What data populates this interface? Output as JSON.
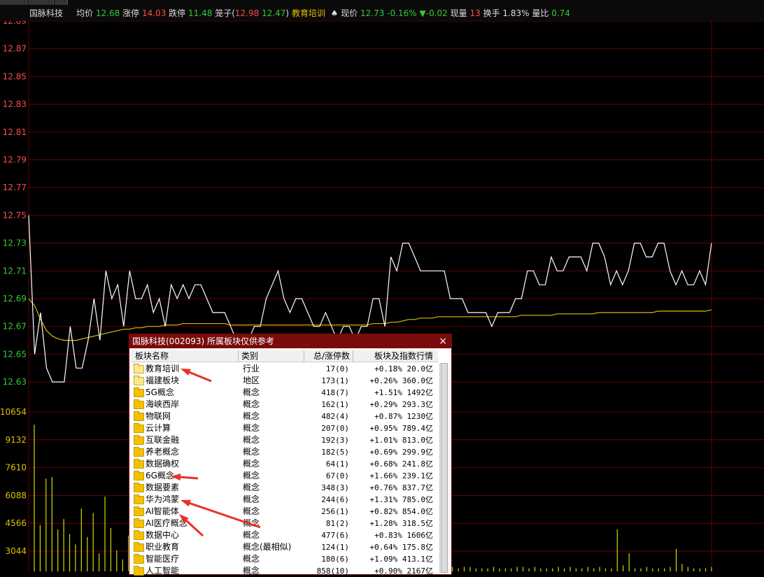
{
  "header": {
    "stock_name": "国脉科技",
    "avg_label": "均价",
    "avg_value": "12.68",
    "limit_up_label": "涨停",
    "limit_up_value": "14.03",
    "limit_down_label": "跌停",
    "limit_down_value": "11.48",
    "bidask_label": "笼子(",
    "bidask_high": "12.98",
    "bidask_low": "12.47",
    "bidask_close": ")",
    "sector": "教育培训",
    "price_label": "现价",
    "price_value": "12.73",
    "change_pct": "-0.16%",
    "change_arrow": "▼",
    "change_value": "-0.02",
    "volume_label": "现量",
    "volume_value": "13",
    "turnover_label": "换手",
    "turnover_value": "1.83%",
    "vol_ratio_label": "量比",
    "vol_ratio_value": "0.74"
  },
  "colors": {
    "up": "#ff4b4b",
    "down": "#33cc33",
    "avg_line": "#d4c000",
    "price_line": "#ffffff",
    "grid": "#6b0000",
    "volume": "#d9d900"
  },
  "chart_data": {
    "type": "line",
    "price_ticks": [
      "12.89",
      "12.87",
      "12.85",
      "12.83",
      "12.81",
      "12.79",
      "12.77",
      "12.75",
      "12.73",
      "12.71",
      "12.69",
      "12.67",
      "12.65",
      "12.63"
    ],
    "volume_ticks": [
      "10654",
      "9132",
      "7610",
      "6088",
      "4566",
      "3044"
    ],
    "ylim": [
      12.63,
      12.89
    ],
    "series": [
      {
        "values": [
          12.75,
          12.65,
          12.68,
          12.64,
          12.63,
          12.63,
          12.63,
          12.67,
          12.64,
          12.64,
          12.66,
          12.69,
          12.66,
          12.71,
          12.69,
          12.7,
          12.67,
          12.71,
          12.69,
          12.69,
          12.7,
          12.68,
          12.69,
          12.67,
          12.7,
          12.69,
          12.7,
          12.69,
          12.7,
          12.7,
          12.69,
          12.68,
          12.68,
          12.68,
          12.67,
          12.66,
          12.66,
          12.66,
          12.67,
          12.67,
          12.69,
          12.7,
          12.71,
          12.69,
          12.68,
          12.69,
          12.69,
          12.68,
          12.67,
          12.67,
          12.68,
          12.67,
          12.66,
          12.67,
          12.67,
          12.66,
          12.67,
          12.67,
          12.69,
          12.69,
          12.67,
          12.72,
          12.71,
          12.73,
          12.73,
          12.72,
          12.71,
          12.71,
          12.71,
          12.71,
          12.71,
          12.69,
          12.69,
          12.69,
          12.68,
          12.68,
          12.68,
          12.68,
          12.67,
          12.68,
          12.68,
          12.68,
          12.69,
          12.69,
          12.71,
          12.71,
          12.7,
          12.7,
          12.72,
          12.71,
          12.71,
          12.72,
          12.72,
          12.72,
          12.71,
          12.73,
          12.73,
          12.72,
          12.7,
          12.71,
          12.7,
          12.71,
          12.73,
          12.73,
          12.72,
          12.72,
          12.73,
          12.73,
          12.71,
          12.7,
          12.71,
          12.7,
          12.7,
          12.71,
          12.7,
          12.73
        ]
      },
      {
        "values": [
          12.69,
          12.685,
          12.675,
          12.667,
          12.663,
          12.661,
          12.66,
          12.66,
          12.66,
          12.661,
          12.662,
          12.663,
          12.664,
          12.665,
          12.666,
          12.667,
          12.668,
          12.668,
          12.669,
          12.669,
          12.67,
          12.67,
          12.67,
          12.671,
          12.671,
          12.671,
          12.672,
          12.672,
          12.672,
          12.672,
          12.672,
          12.672,
          12.672,
          12.672,
          12.671,
          12.671,
          12.671,
          12.671,
          12.671,
          12.671,
          12.671,
          12.671,
          12.671,
          12.671,
          12.671,
          12.671,
          12.671,
          12.671,
          12.671,
          12.671,
          12.671,
          12.671,
          12.671,
          12.671,
          12.671,
          12.671,
          12.671,
          12.671,
          12.672,
          12.672,
          12.672,
          12.673,
          12.673,
          12.674,
          12.675,
          12.675,
          12.676,
          12.676,
          12.676,
          12.677,
          12.677,
          12.677,
          12.677,
          12.677,
          12.677,
          12.677,
          12.677,
          12.677,
          12.677,
          12.677,
          12.677,
          12.677,
          12.677,
          12.678,
          12.678,
          12.678,
          12.678,
          12.678,
          12.678,
          12.679,
          12.679,
          12.679,
          12.679,
          12.679,
          12.679,
          12.679,
          12.68,
          12.68,
          12.68,
          12.68,
          12.68,
          12.68,
          12.68,
          12.68,
          12.68,
          12.68,
          12.681,
          12.681,
          12.681,
          12.681,
          12.681,
          12.681,
          12.681,
          12.681,
          12.681,
          12.682
        ]
      }
    ],
    "volume_values": [
      9800,
      3100,
      6200,
      6300,
      2800,
      3500,
      2500,
      1800,
      4200,
      2300,
      3900,
      1200,
      5000,
      2900,
      1400,
      800,
      2400,
      1500,
      900,
      500,
      600,
      700,
      1800,
      600,
      1100,
      400,
      300,
      600,
      500,
      300,
      500,
      400,
      800,
      300,
      200,
      600,
      300,
      200,
      400,
      700,
      300,
      300,
      200,
      300,
      400,
      300,
      200,
      300,
      500,
      300,
      400,
      200,
      300,
      200,
      200,
      300,
      200,
      300,
      300,
      200,
      500,
      400,
      200,
      300,
      400,
      300,
      200,
      200,
      300,
      200,
      200,
      300,
      200,
      300,
      300,
      200,
      200,
      200,
      300,
      200,
      200,
      200,
      300,
      300,
      200,
      300,
      200,
      200,
      200,
      300,
      200,
      300,
      200,
      200,
      300,
      200,
      300,
      200,
      200,
      2800,
      400,
      1200,
      200,
      200,
      300,
      200,
      200,
      200,
      300,
      1500,
      500,
      300,
      200,
      200,
      200,
      300
    ]
  },
  "dialog": {
    "title": "国脉科技(002093)   所属板块仅供参考",
    "close": "×",
    "headers": [
      "板块名称",
      "类别",
      "总/涨停数",
      "板块及指数行情"
    ],
    "rows": [
      {
        "name": "教育培训",
        "cat": "行业",
        "cnt": "17(0)",
        "chg": "+0.18% 20.0亿",
        "light": true
      },
      {
        "name": "福建板块",
        "cat": "地区",
        "cnt": "173(1)",
        "chg": "+0.26% 360.0亿",
        "light": true
      },
      {
        "name": "5G概念",
        "cat": "概念",
        "cnt": "418(7)",
        "chg": "+1.51% 1492亿"
      },
      {
        "name": "海峡西岸",
        "cat": "概念",
        "cnt": "162(1)",
        "chg": "+0.29% 293.3亿"
      },
      {
        "name": "物联网",
        "cat": "概念",
        "cnt": "482(4)",
        "chg": "+0.87% 1230亿"
      },
      {
        "name": "云计算",
        "cat": "概念",
        "cnt": "207(0)",
        "chg": "+0.95% 789.4亿"
      },
      {
        "name": "互联金融",
        "cat": "概念",
        "cnt": "192(3)",
        "chg": "+1.01% 813.0亿"
      },
      {
        "name": "养老概念",
        "cat": "概念",
        "cnt": "182(5)",
        "chg": "+0.69% 299.9亿"
      },
      {
        "name": "数据确权",
        "cat": "概念",
        "cnt": "64(1)",
        "chg": "+0.68% 241.8亿"
      },
      {
        "name": "6G概念",
        "cat": "概念",
        "cnt": "67(0)",
        "chg": "+1.66% 239.1亿"
      },
      {
        "name": "数据要素",
        "cat": "概念",
        "cnt": "348(3)",
        "chg": "+0.76% 837.7亿"
      },
      {
        "name": "华为鸿蒙",
        "cat": "概念",
        "cnt": "244(6)",
        "chg": "+1.31% 785.0亿"
      },
      {
        "name": "AI智能体",
        "cat": "概念",
        "cnt": "256(1)",
        "chg": "+0.82% 854.0亿"
      },
      {
        "name": "AI医疗概念",
        "cat": "概念",
        "cnt": "81(2)",
        "chg": "+1.28% 318.5亿"
      },
      {
        "name": "数据中心",
        "cat": "概念",
        "cnt": "477(6)",
        "chg": "+0.83% 1606亿"
      },
      {
        "name": "职业教育",
        "cat": "概念(最相似)",
        "cnt": "124(1)",
        "chg": "+0.64% 175.8亿"
      },
      {
        "name": "智能医疗",
        "cat": "概念",
        "cnt": "180(6)",
        "chg": "+1.09% 413.1亿"
      },
      {
        "name": "人工智能",
        "cat": "概念",
        "cnt": "858(10)",
        "chg": "+0.90% 2167亿"
      }
    ]
  }
}
